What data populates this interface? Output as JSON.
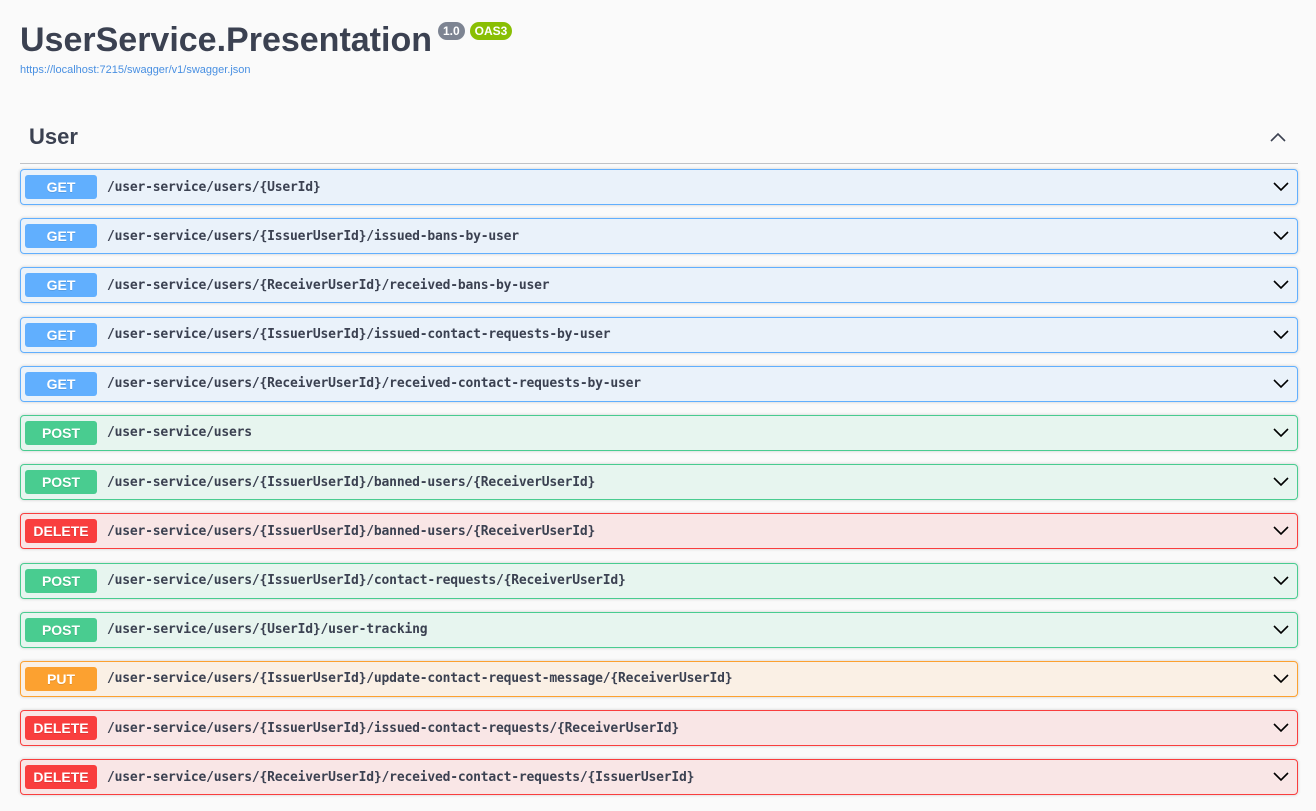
{
  "info": {
    "title": "UserService.Presentation",
    "version_badge": "1.0",
    "oas_badge": "OAS3",
    "spec_url": "https://localhost:7215/swagger/v1/swagger.json"
  },
  "tag": {
    "name": "User",
    "collapse_icon": "chevron-up-icon"
  },
  "colors": {
    "get": "#61affe",
    "post": "#49cc90",
    "delete": "#f93e3e",
    "put": "#fca130",
    "link": "#4990e2",
    "version_badge": "#7d8492",
    "oas_badge": "#89bf04"
  },
  "operations": [
    {
      "method": "GET",
      "path": "/user-service/users/{UserId}"
    },
    {
      "method": "GET",
      "path": "/user-service/users/{IssuerUserId}/issued-bans-by-user"
    },
    {
      "method": "GET",
      "path": "/user-service/users/{ReceiverUserId}/received-bans-by-user"
    },
    {
      "method": "GET",
      "path": "/user-service/users/{IssuerUserId}/issued-contact-requests-by-user"
    },
    {
      "method": "GET",
      "path": "/user-service/users/{ReceiverUserId}/received-contact-requests-by-user"
    },
    {
      "method": "POST",
      "path": "/user-service/users"
    },
    {
      "method": "POST",
      "path": "/user-service/users/{IssuerUserId}/banned-users/{ReceiverUserId}"
    },
    {
      "method": "DELETE",
      "path": "/user-service/users/{IssuerUserId}/banned-users/{ReceiverUserId}"
    },
    {
      "method": "POST",
      "path": "/user-service/users/{IssuerUserId}/contact-requests/{ReceiverUserId}"
    },
    {
      "method": "POST",
      "path": "/user-service/users/{UserId}/user-tracking"
    },
    {
      "method": "PUT",
      "path": "/user-service/users/{IssuerUserId}/update-contact-request-message/{ReceiverUserId}"
    },
    {
      "method": "DELETE",
      "path": "/user-service/users/{IssuerUserId}/issued-contact-requests/{ReceiverUserId}"
    },
    {
      "method": "DELETE",
      "path": "/user-service/users/{ReceiverUserId}/received-contact-requests/{IssuerUserId}"
    }
  ]
}
